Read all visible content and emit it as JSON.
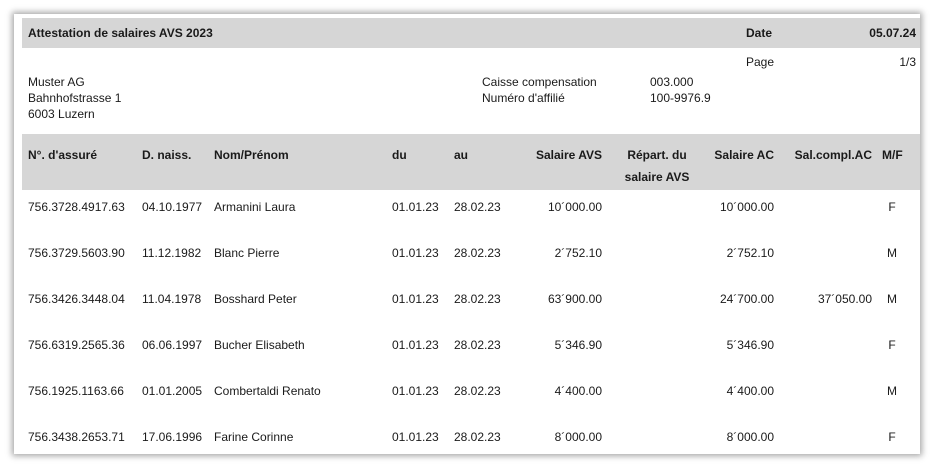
{
  "header": {
    "title": "Attestation de salaires AVS 2023",
    "date_label": "Date",
    "date_value": "05.07.24",
    "page_label": "Page",
    "page_value": "1/3"
  },
  "company": {
    "lines": [
      "Muster AG",
      "Bahnhofstrasse 1",
      "6003 Luzern"
    ]
  },
  "caisse": {
    "labels": [
      "Caisse compensation",
      "Numéro d'affilié"
    ],
    "values": [
      "003.000",
      "100-9976.9"
    ]
  },
  "columns": {
    "no_assure": "N°. d'assuré",
    "d_naiss": "D. naiss.",
    "nom": "Nom/Prénom",
    "du": "du",
    "au": "au",
    "salaire_avs": "Salaire AVS",
    "repart_1": "Répart. du",
    "repart_2": "salaire AVS",
    "salaire_ac": "Salaire AC",
    "sal_compl": "Sal.compl.AC",
    "mf": "M/F"
  },
  "rows": [
    {
      "no": "756.3728.4917.63",
      "dn": "04.10.1977",
      "nom": "Armanini Laura",
      "du": "01.01.23",
      "au": "28.02.23",
      "avs": "10´000.00",
      "rep": "",
      "ac": "10´000.00",
      "compl": "",
      "mf": "F"
    },
    {
      "no": "756.3729.5603.90",
      "dn": "11.12.1982",
      "nom": "Blanc Pierre",
      "du": "01.01.23",
      "au": "28.02.23",
      "avs": "2´752.10",
      "rep": "",
      "ac": "2´752.10",
      "compl": "",
      "mf": "M"
    },
    {
      "no": "756.3426.3448.04",
      "dn": "11.04.1978",
      "nom": "Bosshard Peter",
      "du": "01.01.23",
      "au": "28.02.23",
      "avs": "63´900.00",
      "rep": "",
      "ac": "24´700.00",
      "compl": "37´050.00",
      "mf": "M"
    },
    {
      "no": "756.6319.2565.36",
      "dn": "06.06.1997",
      "nom": "Bucher Elisabeth",
      "du": "01.01.23",
      "au": "28.02.23",
      "avs": "5´346.90",
      "rep": "",
      "ac": "5´346.90",
      "compl": "",
      "mf": "F"
    },
    {
      "no": "756.1925.1163.66",
      "dn": "01.01.2005",
      "nom": "Combertaldi Renato",
      "du": "01.01.23",
      "au": "28.02.23",
      "avs": "4´400.00",
      "rep": "",
      "ac": "4´400.00",
      "compl": "",
      "mf": "M"
    },
    {
      "no": "756.3438.2653.71",
      "dn": "17.06.1996",
      "nom": "Farine Corinne",
      "du": "01.01.23",
      "au": "28.02.23",
      "avs": "8´000.00",
      "rep": "",
      "ac": "8´000.00",
      "compl": "",
      "mf": "F"
    }
  ]
}
